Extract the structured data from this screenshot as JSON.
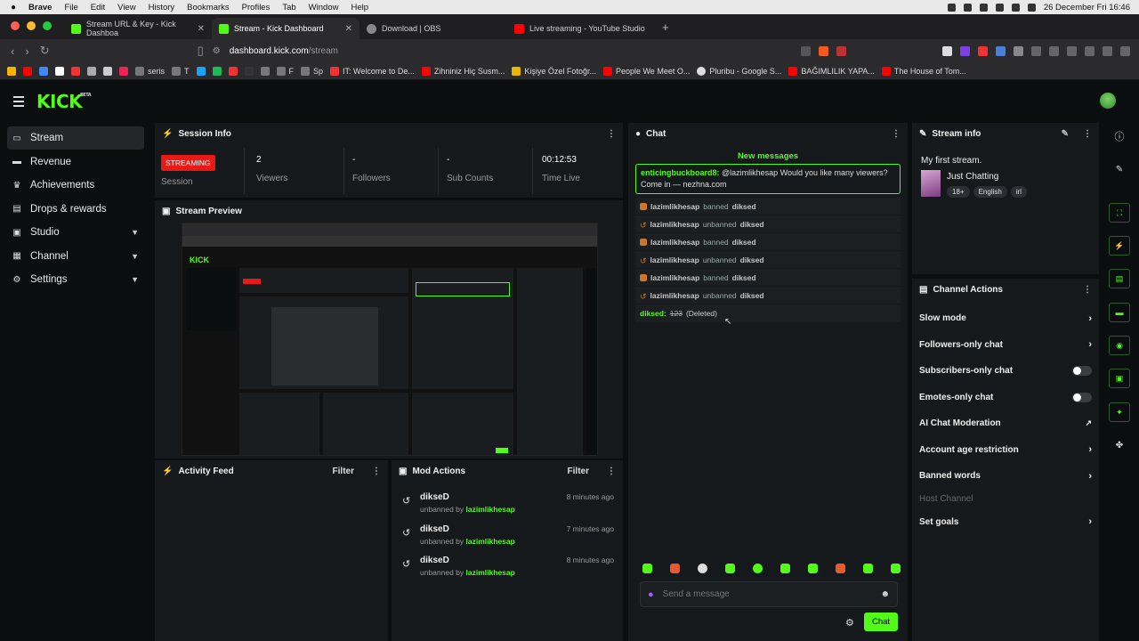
{
  "menubar": {
    "app": "Brave",
    "items": [
      "File",
      "Edit",
      "View",
      "History",
      "Bookmarks",
      "Profiles",
      "Tab",
      "Window",
      "Help"
    ],
    "datetime": "26 December Fri 16:46"
  },
  "tabs": [
    {
      "label": "Stream URL & Key - Kick Dashboa",
      "color": "#53fc18"
    },
    {
      "label": "Stream - Kick Dashboard",
      "color": "#53fc18"
    },
    {
      "label": "Download | OBS",
      "color": "#888888"
    },
    {
      "label": "Live streaming - YouTube Studio",
      "color": "#ff0000"
    }
  ],
  "address": {
    "domain": "dashboard.kick.com",
    "path": "/stream"
  },
  "bookmarks": [
    "seris",
    "T",
    "F",
    "Sp",
    "IT: Welcome to De...",
    "Zihniniz Hiç Susm...",
    "Kişiye Özel Fotoğr...",
    "People We Meet O...",
    "Pluribu - Google S...",
    "BAĞIMLILIK YAPA...",
    "The House of Tom..."
  ],
  "sidebar": {
    "items": [
      {
        "label": "Stream",
        "icon": "monitor-icon"
      },
      {
        "label": "Revenue",
        "icon": "wallet-icon"
      },
      {
        "label": "Achievements",
        "icon": "trophy-icon"
      },
      {
        "label": "Drops & rewards",
        "icon": "gift-icon"
      },
      {
        "label": "Studio",
        "icon": "studio-icon"
      },
      {
        "label": "Channel",
        "icon": "channel-icon"
      },
      {
        "label": "Settings",
        "icon": "gear-icon"
      }
    ]
  },
  "session": {
    "title": "Session Info",
    "status": "STREAMING",
    "session_label": "Session",
    "viewers": "2",
    "viewers_label": "Viewers",
    "followers": "-",
    "followers_label": "Followers",
    "subs": "-",
    "subs_label": "Sub Counts",
    "time": "00:12:53",
    "time_label": "Time Live"
  },
  "preview": {
    "title": "Stream Preview"
  },
  "chat": {
    "title": "Chat",
    "new_messages": "New messages",
    "highlight_user": "enticingbuckboard8:",
    "highlight_text": "@lazimlikhesap Would you like many viewers? Come in — nezhna.com",
    "events": [
      {
        "actor": "lazimlikhesap",
        "verb": "banned",
        "target": "diksed"
      },
      {
        "actor": "lazimlikhesap",
        "verb": "unbanned",
        "target": "diksed"
      },
      {
        "actor": "lazimlikhesap",
        "verb": "banned",
        "target": "diksed"
      },
      {
        "actor": "lazimlikhesap",
        "verb": "unbanned",
        "target": "diksed"
      },
      {
        "actor": "lazimlikhesap",
        "verb": "banned",
        "target": "diksed"
      },
      {
        "actor": "lazimlikhesap",
        "verb": "unbanned",
        "target": "diksed"
      }
    ],
    "deleted_user": "diksed:",
    "deleted_text": "123",
    "deleted_tag": "(Deleted)",
    "input_placeholder": "Send a message",
    "send_label": "Chat"
  },
  "stream_info": {
    "title": "Stream info",
    "stream_title": "My first stream.",
    "category": "Just Chatting",
    "tags": [
      "18+",
      "English",
      "irl"
    ]
  },
  "channel_actions": {
    "title": "Channel Actions",
    "items": [
      {
        "label": "Slow mode"
      },
      {
        "label": "Followers-only chat"
      },
      {
        "label": "Subscribers-only chat"
      },
      {
        "label": "Emotes-only chat"
      },
      {
        "label": "AI Chat Moderation"
      },
      {
        "label": "Account age restriction"
      },
      {
        "label": "Banned words"
      },
      {
        "label": "Host Channel"
      },
      {
        "label": "Set goals"
      }
    ]
  },
  "activity": {
    "title": "Activity Feed",
    "filter": "Filter"
  },
  "mod_actions": {
    "title": "Mod Actions",
    "filter": "Filter",
    "rows": [
      {
        "user": "dikseD",
        "action": "unbanned by",
        "by": "lazimlikhesap",
        "time": "8 minutes ago"
      },
      {
        "user": "dikseD",
        "action": "unbanned by",
        "by": "lazimlikhesap",
        "time": "7 minutes ago"
      },
      {
        "user": "dikseD",
        "action": "unbanned by",
        "by": "lazimlikhesap",
        "time": "8 minutes ago"
      }
    ]
  },
  "colors": {
    "accent": "#53fc18",
    "live": "#e91916",
    "panel": "#16191b",
    "bg": "#0b0e0f"
  }
}
